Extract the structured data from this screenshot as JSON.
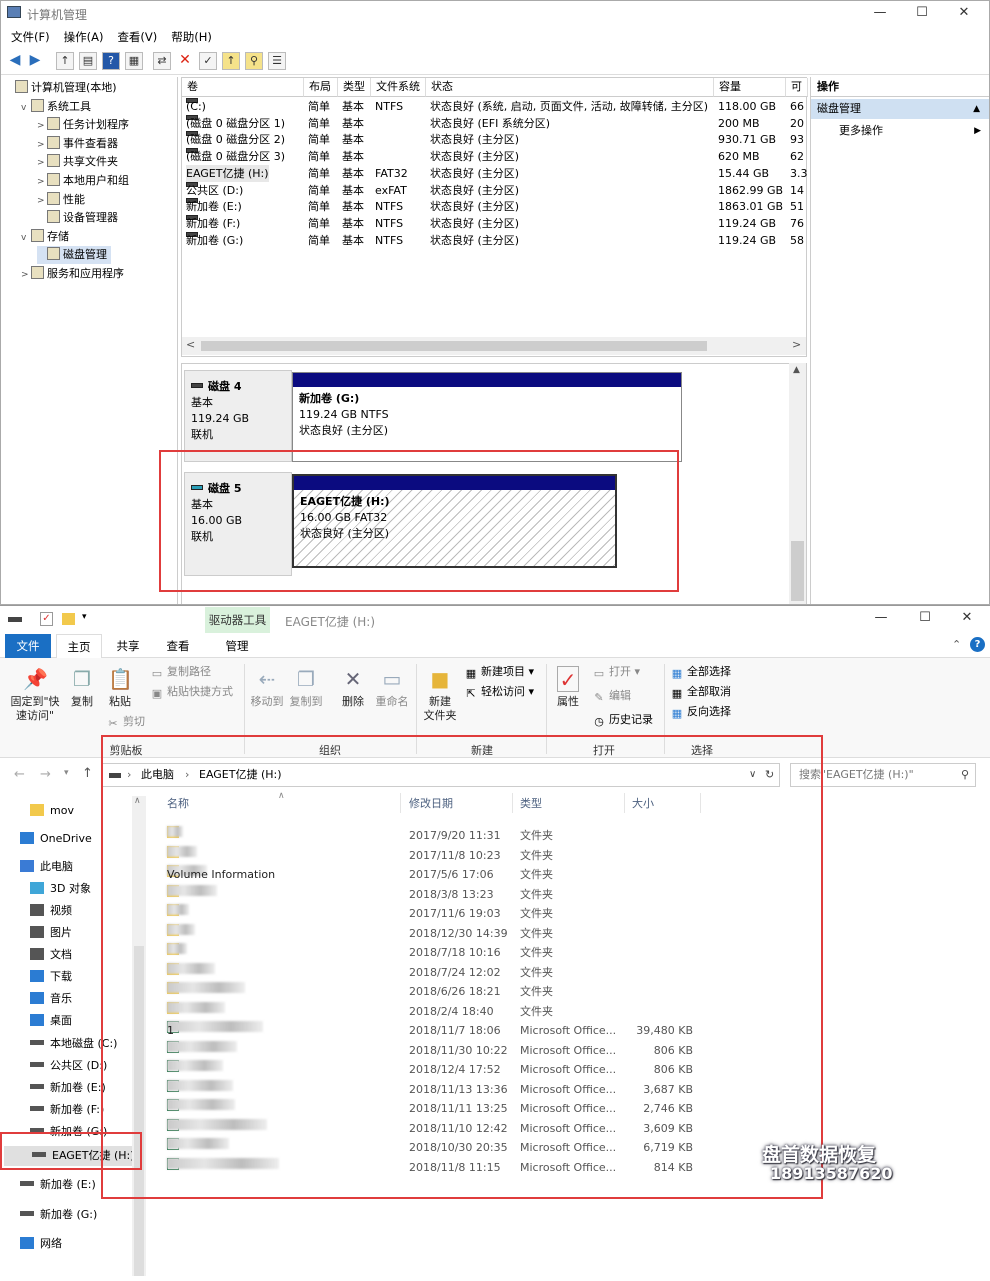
{
  "cm": {
    "title": "计算机管理",
    "menu": [
      "文件(F)",
      "操作(A)",
      "查看(V)",
      "帮助(H)"
    ],
    "tree": [
      {
        "label": "计算机管理(本地)",
        "level": 0,
        "expand": ""
      },
      {
        "label": "系统工具",
        "level": 1,
        "expand": "v"
      },
      {
        "label": "任务计划程序",
        "level": 2,
        "expand": ">"
      },
      {
        "label": "事件查看器",
        "level": 2,
        "expand": ">"
      },
      {
        "label": "共享文件夹",
        "level": 2,
        "expand": ">"
      },
      {
        "label": "本地用户和组",
        "level": 2,
        "expand": ">"
      },
      {
        "label": "性能",
        "level": 2,
        "expand": ">"
      },
      {
        "label": "设备管理器",
        "level": 2,
        "expand": ""
      },
      {
        "label": "存储",
        "level": 1,
        "expand": "v"
      },
      {
        "label": "磁盘管理",
        "level": 2,
        "expand": ""
      },
      {
        "label": "服务和应用程序",
        "level": 1,
        "expand": ">"
      }
    ],
    "columns": [
      "卷",
      "布局",
      "类型",
      "文件系统",
      "状态",
      "容量",
      "可"
    ],
    "volumes": [
      {
        "name": "(C:)",
        "layout": "简单",
        "type": "基本",
        "fs": "NTFS",
        "status": "状态良好 (系统, 启动, 页面文件, 活动, 故障转储, 主分区)",
        "cap": "118.00 GB",
        "free": "66"
      },
      {
        "name": "(磁盘 0 磁盘分区 1)",
        "layout": "简单",
        "type": "基本",
        "fs": "",
        "status": "状态良好 (EFI 系统分区)",
        "cap": "200 MB",
        "free": "20"
      },
      {
        "name": "(磁盘 0 磁盘分区 2)",
        "layout": "简单",
        "type": "基本",
        "fs": "",
        "status": "状态良好 (主分区)",
        "cap": "930.71 GB",
        "free": "93"
      },
      {
        "name": "(磁盘 0 磁盘分区 3)",
        "layout": "简单",
        "type": "基本",
        "fs": "",
        "status": "状态良好 (主分区)",
        "cap": "620 MB",
        "free": "62"
      },
      {
        "name": "EAGET亿捷 (H:)",
        "layout": "简单",
        "type": "基本",
        "fs": "FAT32",
        "status": "状态良好 (主分区)",
        "cap": "15.44 GB",
        "free": "3.3"
      },
      {
        "name": "公共区 (D:)",
        "layout": "简单",
        "type": "基本",
        "fs": "exFAT",
        "status": "状态良好 (主分区)",
        "cap": "1862.99 GB",
        "free": "14"
      },
      {
        "name": "新加卷 (E:)",
        "layout": "简单",
        "type": "基本",
        "fs": "NTFS",
        "status": "状态良好 (主分区)",
        "cap": "1863.01 GB",
        "free": "51"
      },
      {
        "name": "新加卷 (F:)",
        "layout": "简单",
        "type": "基本",
        "fs": "NTFS",
        "status": "状态良好 (主分区)",
        "cap": "119.24 GB",
        "free": "76"
      },
      {
        "name": "新加卷 (G:)",
        "layout": "简单",
        "type": "基本",
        "fs": "NTFS",
        "status": "状态良好 (主分区)",
        "cap": "119.24 GB",
        "free": "58"
      }
    ],
    "disk4": {
      "name": "磁盘 4",
      "type": "基本",
      "size": "119.24 GB",
      "state": "联机",
      "part_name": "新加卷  (G:)",
      "part_size": "119.24 GB NTFS",
      "part_status": "状态良好 (主分区)"
    },
    "disk5": {
      "name": "磁盘 5",
      "type": "基本",
      "size": "16.00 GB",
      "state": "联机",
      "part_name": "EAGET亿捷  (H:)",
      "part_size": "16.00 GB FAT32",
      "part_status": "状态良好 (主分区)"
    },
    "actions": {
      "header": "操作",
      "selected": "磁盘管理",
      "more": "更多操作"
    }
  },
  "ex": {
    "title": "EAGET亿捷 (H:)",
    "drive_tools": "驱动器工具",
    "tabs": [
      "文件",
      "主页",
      "共享",
      "查看",
      "管理"
    ],
    "ribbon": {
      "pin": "固定到\"快\n速访问\"",
      "copy": "复制",
      "paste": "粘贴",
      "cut": "剪切",
      "copy_path": "复制路径",
      "paste_shortcut": "粘贴快捷方式",
      "move_to": "移动到",
      "copy_to": "复制到",
      "delete": "删除",
      "rename": "重命名",
      "new_folder": "新建\n文件夹",
      "new_item": "新建项目",
      "easy_access": "轻松访问",
      "properties": "属性",
      "open": "打开",
      "edit": "编辑",
      "history": "历史记录",
      "select_all": "全部选择",
      "select_none": "全部取消",
      "invert": "反向选择"
    },
    "groups": [
      "剪贴板",
      "组织",
      "新建",
      "打开",
      "选择"
    ],
    "breadcrumb": [
      "此电脑",
      "EAGET亿捷 (H:)"
    ],
    "search_placeholder": "搜索\"EAGET亿捷 (H:)\"",
    "nav": [
      {
        "label": "mov",
        "color": "#f2c94c"
      },
      {
        "label": "OneDrive",
        "color": "#2b7cd3"
      },
      {
        "label": "此电脑",
        "color": "#3a7bd5"
      },
      {
        "label": "3D 对象",
        "color": "#3fa6d8"
      },
      {
        "label": "视频",
        "color": "#555"
      },
      {
        "label": "图片",
        "color": "#555"
      },
      {
        "label": "文档",
        "color": "#555"
      },
      {
        "label": "下载",
        "color": "#2b7cd3"
      },
      {
        "label": "音乐",
        "color": "#2b7cd3"
      },
      {
        "label": "桌面",
        "color": "#2b7cd3"
      },
      {
        "label": "本地磁盘 (C:)",
        "color": "#555"
      },
      {
        "label": "公共区 (D:)",
        "color": "#555"
      },
      {
        "label": "新加卷 (E:)",
        "color": "#555"
      },
      {
        "label": "新加卷 (F:)",
        "color": "#555"
      },
      {
        "label": "新加卷 (G:)",
        "color": "#555"
      },
      {
        "label": "EAGET亿捷 (H:)",
        "color": "#555"
      },
      {
        "label": "新加卷 (E:)",
        "color": "#555"
      },
      {
        "label": "新加卷 (G:)",
        "color": "#555"
      },
      {
        "label": "网络",
        "color": "#2b7cd3"
      }
    ],
    "columns": [
      "名称",
      "修改日期",
      "类型",
      "大小"
    ],
    "files": [
      {
        "name": "",
        "date": "2017/9/20 11:31",
        "type": "文件夹",
        "size": "",
        "kind": "folder",
        "blur": 16
      },
      {
        "name": "",
        "date": "2017/11/8 10:23",
        "type": "文件夹",
        "size": "",
        "kind": "folder",
        "blur": 30
      },
      {
        "name": "Volume Information",
        "date": "2017/5/6 17:06",
        "type": "文件夹",
        "size": "",
        "kind": "folder",
        "blur": 40
      },
      {
        "name": "",
        "date": "2018/3/8 13:23",
        "type": "文件夹",
        "size": "",
        "kind": "folder",
        "blur": 50
      },
      {
        "name": "",
        "date": "2017/11/6 19:03",
        "type": "文件夹",
        "size": "",
        "kind": "folder",
        "blur": 22
      },
      {
        "name": "",
        "date": "2018/12/30 14:39",
        "type": "文件夹",
        "size": "",
        "kind": "folder",
        "blur": 28
      },
      {
        "name": "",
        "date": "2018/7/18 10:16",
        "type": "文件夹",
        "size": "",
        "kind": "folder",
        "blur": 20
      },
      {
        "name": "",
        "date": "2018/7/24 12:02",
        "type": "文件夹",
        "size": "",
        "kind": "folder",
        "blur": 48
      },
      {
        "name": "",
        "date": "2018/6/26 18:21",
        "type": "文件夹",
        "size": "",
        "kind": "folder",
        "blur": 78
      },
      {
        "name": "",
        "date": "2018/2/4 18:40",
        "type": "文件夹",
        "size": "",
        "kind": "folder",
        "blur": 58
      },
      {
        "name": "1",
        "date": "2018/11/7 18:06",
        "type": "Microsoft Office...",
        "size": "39,480 KB",
        "kind": "excel",
        "blur": 96
      },
      {
        "name": "",
        "date": "2018/11/30 10:22",
        "type": "Microsoft Office...",
        "size": "806 KB",
        "kind": "excel",
        "blur": 70
      },
      {
        "name": "",
        "date": "2018/12/4 17:52",
        "type": "Microsoft Office...",
        "size": "806 KB",
        "kind": "excel",
        "blur": 56
      },
      {
        "name": "",
        "date": "2018/11/13 13:36",
        "type": "Microsoft Office...",
        "size": "3,687 KB",
        "kind": "excel",
        "blur": 66
      },
      {
        "name": "",
        "date": "2018/11/11 13:25",
        "type": "Microsoft Office...",
        "size": "2,746 KB",
        "kind": "excel",
        "blur": 68
      },
      {
        "name": "",
        "date": "2018/11/10 12:42",
        "type": "Microsoft Office...",
        "size": "3,609 KB",
        "kind": "excel",
        "blur": 100
      },
      {
        "name": "",
        "date": "2018/10/30 20:35",
        "type": "Microsoft Office...",
        "size": "6,719 KB",
        "kind": "excel",
        "blur": 62
      },
      {
        "name": "",
        "date": "2018/11/8 11:15",
        "type": "Microsoft Office...",
        "size": "814 KB",
        "kind": "excel",
        "blur": 112
      }
    ]
  },
  "watermark": {
    "line1": "盘首数据恢复",
    "line2": "18913587620"
  }
}
